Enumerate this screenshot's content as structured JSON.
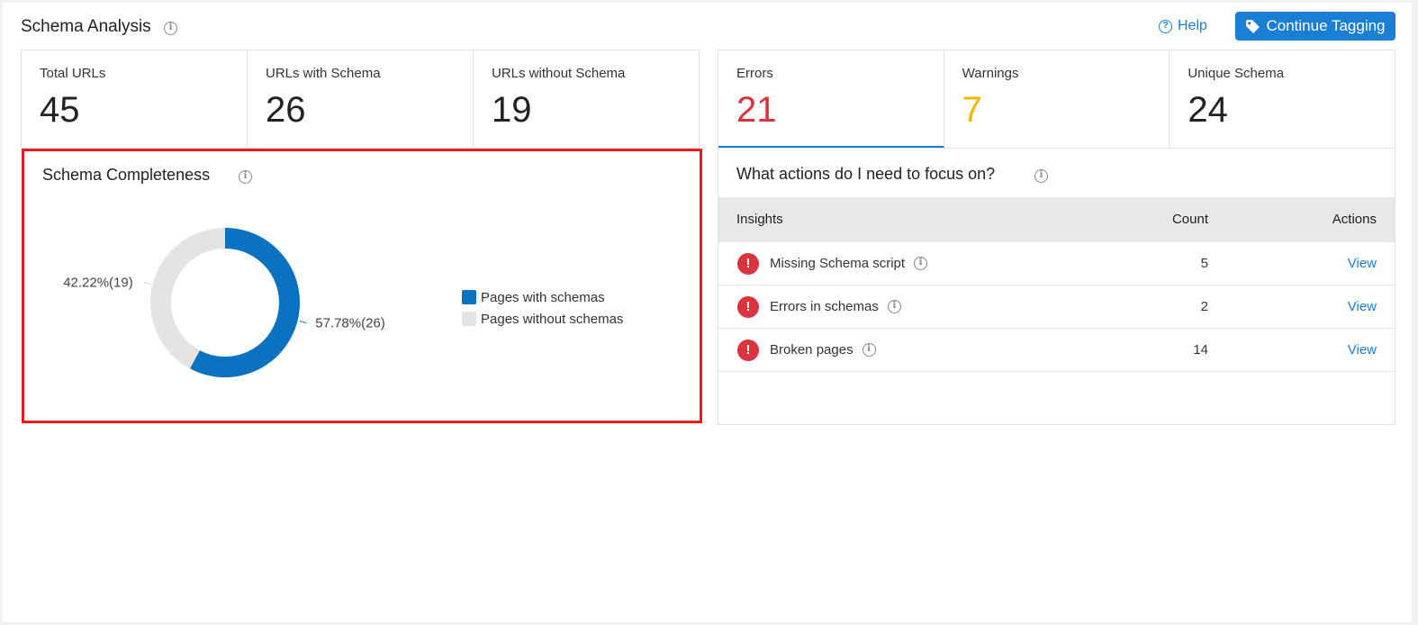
{
  "header": {
    "title": "Schema Analysis",
    "help_label": "Help",
    "continue_label": "Continue Tagging"
  },
  "stats_left": [
    {
      "label": "Total URLs",
      "value": "45"
    },
    {
      "label": "URLs with Schema",
      "value": "26"
    },
    {
      "label": "URLs without Schema",
      "value": "19"
    }
  ],
  "stats_right": [
    {
      "label": "Errors",
      "value": "21"
    },
    {
      "label": "Warnings",
      "value": "7"
    },
    {
      "label": "Unique Schema",
      "value": "24"
    }
  ],
  "completeness": {
    "title": "Schema Completeness"
  },
  "chart_data": {
    "type": "pie",
    "categories": [
      "Pages with schemas",
      "Pages without schemas"
    ],
    "values": [
      26,
      19
    ],
    "percent_labels": [
      "57.78%(26)",
      "42.22%(19)"
    ],
    "colors": [
      "#0b72c2",
      "#e4e4e4"
    ],
    "legend_position": "right",
    "title": ""
  },
  "actions": {
    "title": "What actions do I need to focus on?",
    "columns": {
      "insights": "Insights",
      "count": "Count",
      "actions": "Actions"
    },
    "rows": [
      {
        "label": "Missing Schema script",
        "count": "5",
        "action": "View"
      },
      {
        "label": "Errors in schemas",
        "count": "2",
        "action": "View"
      },
      {
        "label": "Broken pages",
        "count": "14",
        "action": "View"
      }
    ]
  },
  "colors": {
    "accent": "#1a7fd4",
    "error": "#d9333f",
    "warning": "#f5b800",
    "highlight_border": "#e81c1c"
  },
  "icons": {
    "info": "info-icon",
    "help": "help-circle-icon",
    "tag": "tag-icon",
    "error": "exclamation-circle-icon"
  }
}
